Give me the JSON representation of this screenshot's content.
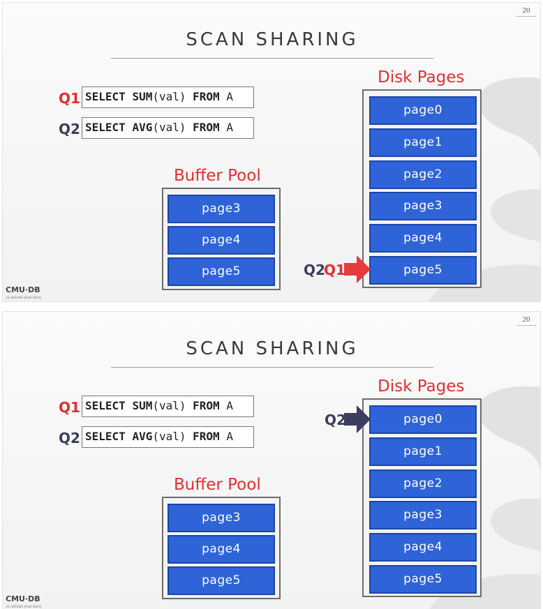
{
  "slides": [
    {
      "page_number": "20",
      "title": "SCAN SHARING",
      "queries": [
        {
          "label": "Q1",
          "kw1": "SELECT",
          "fn": "SUM",
          "arg": "(val)",
          "kw2": "FROM",
          "table": "A"
        },
        {
          "label": "Q2",
          "kw1": "SELECT",
          "fn": "AVG",
          "arg": "(val)",
          "kw2": "FROM",
          "table": "A"
        }
      ],
      "buffer_pool": {
        "title": "Buffer Pool",
        "pages": [
          "page3",
          "page4",
          "page5"
        ]
      },
      "disk_pages": {
        "title": "Disk Pages",
        "pages": [
          "page0",
          "page1",
          "page2",
          "page3",
          "page4",
          "page5"
        ]
      },
      "pointer": {
        "labels": [
          "Q2",
          "Q1"
        ],
        "target": "page5",
        "color": "#e83a3a"
      },
      "footer": {
        "logo": "CMU·DB",
        "course": "15-445/645 (Fall 2021)"
      }
    },
    {
      "page_number": "20",
      "title": "SCAN SHARING",
      "queries": [
        {
          "label": "Q1",
          "kw1": "SELECT",
          "fn": "SUM",
          "arg": "(val)",
          "kw2": "FROM",
          "table": "A"
        },
        {
          "label": "Q2",
          "kw1": "SELECT",
          "fn": "AVG",
          "arg": "(val)",
          "kw2": "FROM",
          "table": "A"
        }
      ],
      "buffer_pool": {
        "title": "Buffer Pool",
        "pages": [
          "page3",
          "page4",
          "page5"
        ]
      },
      "disk_pages": {
        "title": "Disk Pages",
        "pages": [
          "page0",
          "page1",
          "page2",
          "page3",
          "page4",
          "page5"
        ]
      },
      "pointer": {
        "labels": [
          "Q2"
        ],
        "target": "page0",
        "color": "#3b3e5e"
      },
      "footer": {
        "logo": "CMU·DB",
        "course": "15-445/645 (Fall 2021)"
      }
    }
  ],
  "colors": {
    "q1": "#e52d2d",
    "q2": "#3b3e5e",
    "page_fill": "#2e64d8",
    "section_title": "#e52d2d"
  }
}
